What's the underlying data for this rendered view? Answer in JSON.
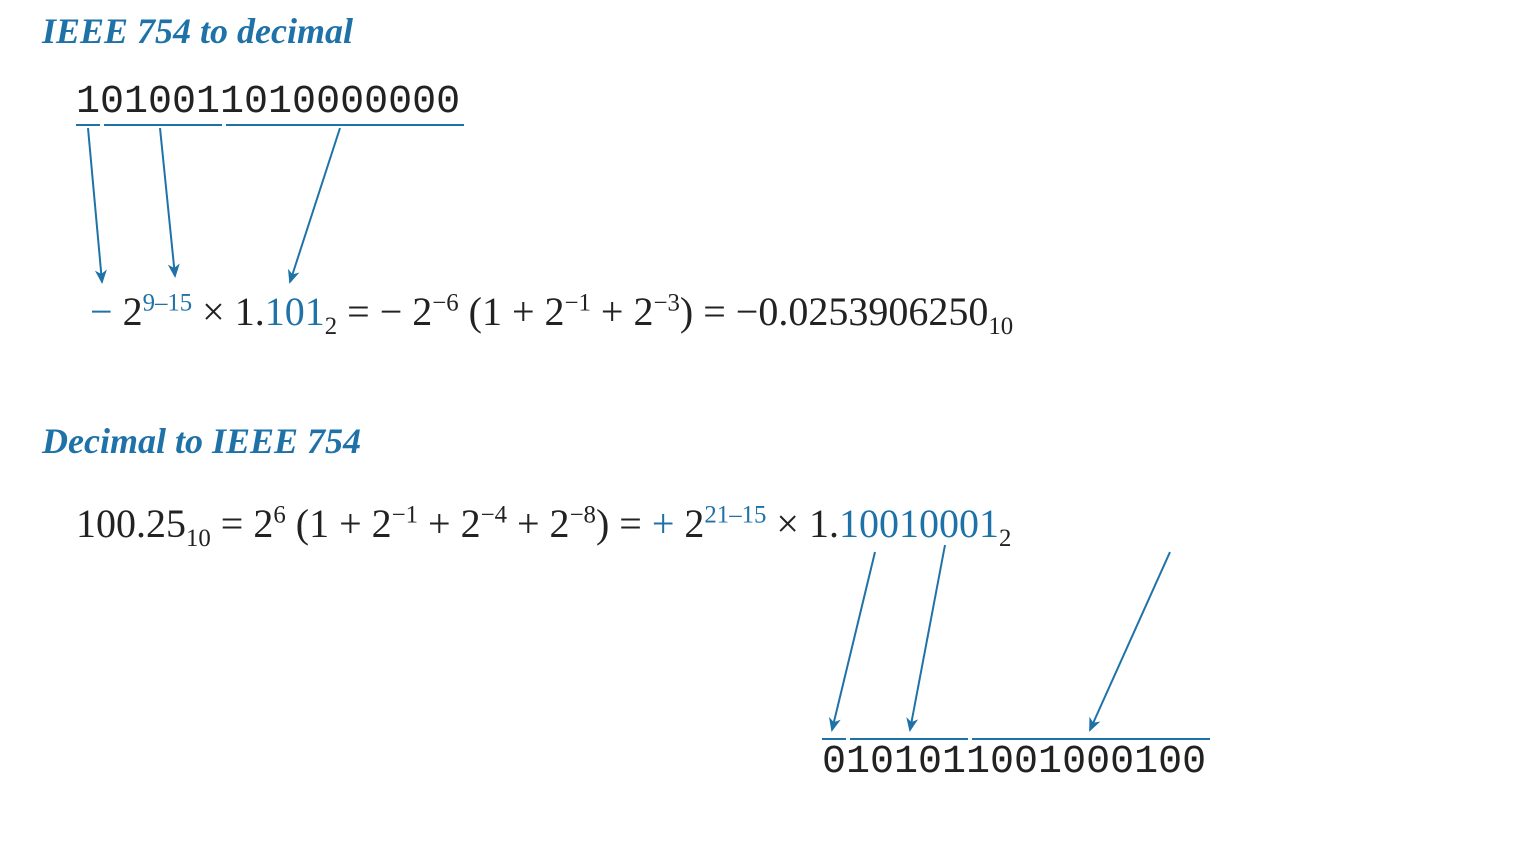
{
  "section1": {
    "title": "IEEE 754 to decimal",
    "bits": {
      "sign": "1",
      "exponent": "01001",
      "mantissa": "1010000000"
    },
    "formula": {
      "sign": "−",
      "two": "2",
      "exp1_blue": "9–15",
      "times": " × 1.",
      "mantissa_blue": "101",
      "base2": "2",
      "eq1": " = ",
      "mid_neg": "− ",
      "two_b": "2",
      "exp2": "−6",
      "paren": " (1 + 2",
      "pw1": "−1",
      "plus": " + 2",
      "pw2": "−3",
      "close": ")",
      "eq2": " = ",
      "res_neg": "−",
      "result": "0.0253906250",
      "base10": "10"
    }
  },
  "section2": {
    "title": "Decimal to IEEE 754",
    "formula": {
      "val": "100.25",
      "base10a": "10",
      "eq1": " = 2",
      "exp6": "6",
      "paren_open": " (1 + 2",
      "p1": "−1",
      "plus_a": " + 2",
      "p2": "−4",
      "plus_b": " + 2",
      "p3": "−8",
      "close": ")",
      "eq2": " = ",
      "plus_sign": "+",
      "space": " ",
      "two": "2",
      "exp_blue": "21–15",
      "times": " × 1.",
      "mant_blue": "10010001",
      "base2": "2"
    },
    "bits": {
      "sign": "0",
      "exponent": "10101",
      "mantissa": "1001000100"
    }
  }
}
